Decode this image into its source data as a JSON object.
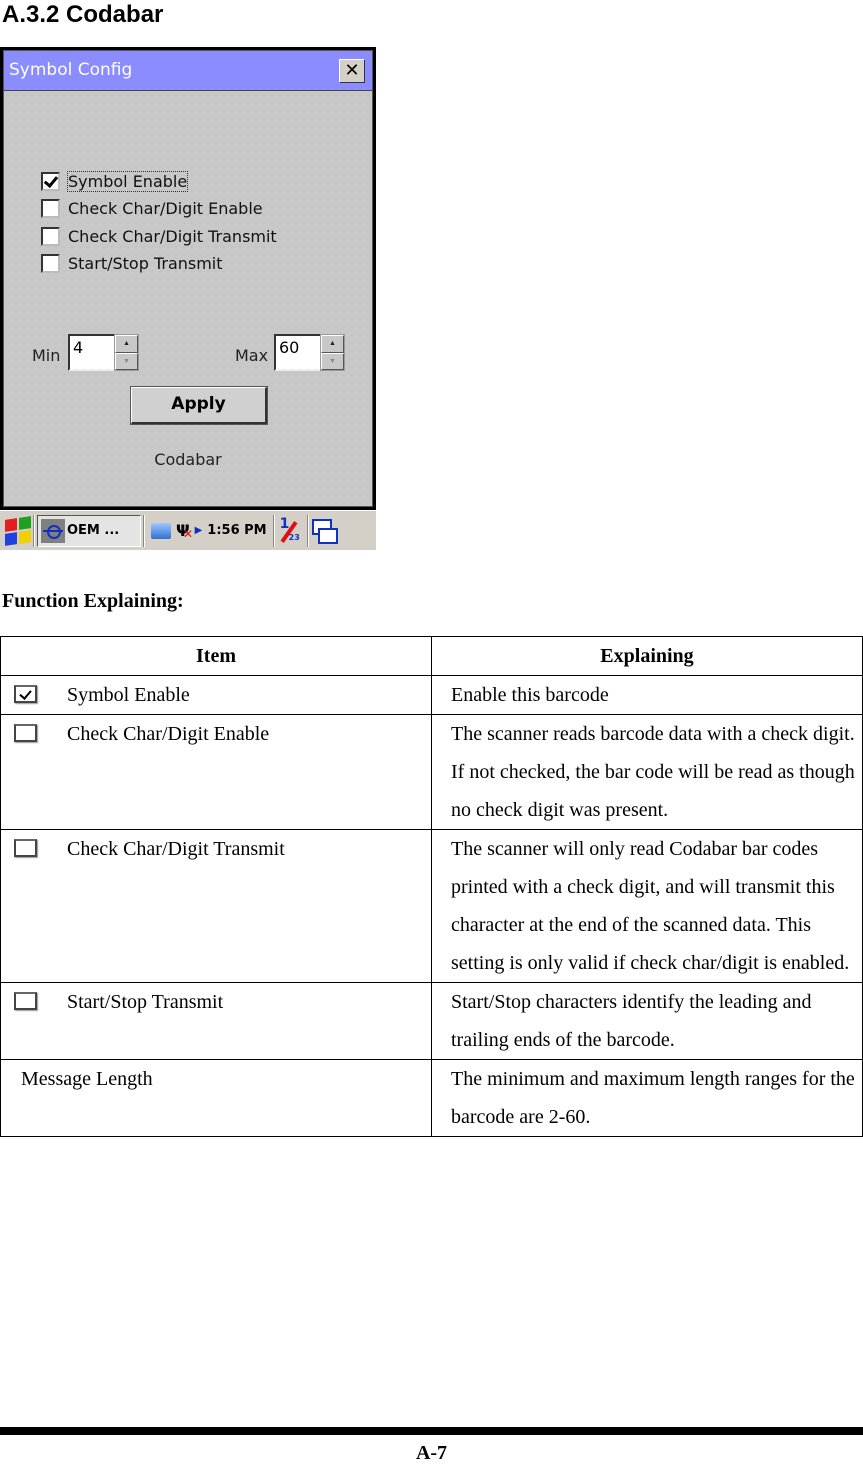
{
  "section_title": "A.3.2 Codabar",
  "device": {
    "window_title": "Symbol Config",
    "close_label": "✕",
    "checkboxes": [
      {
        "label": "Symbol Enable",
        "checked": true
      },
      {
        "label": "Check Char/Digit Enable",
        "checked": false
      },
      {
        "label": "Check Char/Digit Transmit",
        "checked": false
      },
      {
        "label": "Start/Stop Transmit",
        "checked": false
      }
    ],
    "min_label": "Min",
    "min_value": "4",
    "max_label": "Max",
    "max_value": "60",
    "spin_up": "▲",
    "spin_down": "▼",
    "apply_label": "Apply",
    "symbol_name": "Codabar",
    "taskbar": {
      "task_label": "OEM ...",
      "clock": "1:56 PM",
      "input_one": "1",
      "input_sub": "23"
    }
  },
  "function_heading": "Function Explaining:",
  "table": {
    "headers": [
      "Item",
      "Explaining"
    ],
    "rows": [
      {
        "item": "Symbol Enable",
        "checkbox": "checked",
        "explaining": "Enable this barcode"
      },
      {
        "item": "Check Char/Digit Enable",
        "checkbox": "unchecked",
        "explaining": "The scanner reads barcode data with a check digit. If not checked, the bar code will be read as though no check digit was present."
      },
      {
        "item": "Check Char/Digit Transmit",
        "checkbox": "unchecked",
        "explaining": "The scanner will only read Codabar bar codes printed with a check digit, and will transmit this character at the end of the scanned data. This setting is only valid if check char/digit is enabled."
      },
      {
        "item": "Start/Stop Transmit",
        "checkbox": "unchecked",
        "explaining": "Start/Stop characters identify the leading and trailing ends of the barcode."
      },
      {
        "item": "Message Length",
        "checkbox": "none",
        "explaining": "The minimum and maximum length ranges for the barcode are 2-60."
      }
    ]
  },
  "page_number": "A-7",
  "colors": {
    "titlebar": "#8a8cff",
    "window_bg": "#c8c8c8",
    "taskbar_bg": "#d4d0c8"
  }
}
